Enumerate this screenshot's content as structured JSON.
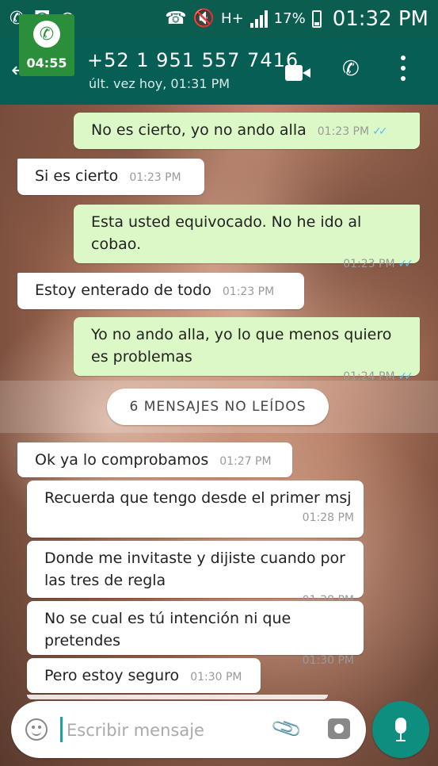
{
  "status_bar": {
    "battery_percent": "17%",
    "time": "01:32 PM",
    "network": "H+"
  },
  "header": {
    "contact": "+52 1 951 557 7416",
    "last_seen": "últ. vez hoy, 01:31 PM",
    "call_duration": "04:55"
  },
  "messages": [
    {
      "dir": "out",
      "text": "No es cierto, yo no ando alla",
      "time": "01:23 PM"
    },
    {
      "dir": "in",
      "text": "Si es cierto",
      "time": "01:23 PM"
    },
    {
      "dir": "out",
      "text": "Esta usted equivocado. No he ido al cobao.",
      "time": "01:23 PM"
    },
    {
      "dir": "in",
      "text": "Estoy enterado de todo",
      "time": "01:23 PM"
    },
    {
      "dir": "out",
      "text": "Yo no ando alla, yo lo que menos quiero es problemas",
      "time": "01:24 PM"
    },
    {
      "dir": "in",
      "text": "Ok ya lo comprobamos",
      "time": "01:27 PM"
    },
    {
      "dir": "in",
      "text": "Recuerda que tengo desde el primer msj",
      "time": "01:28 PM"
    },
    {
      "dir": "in",
      "text": "Donde me invitaste y dijiste cuando por las tres de regla",
      "time": "01:28 PM"
    },
    {
      "dir": "in",
      "text": "No se cual es tú intención ni que pretendes",
      "time": "01:30 PM"
    },
    {
      "dir": "in",
      "text": "Pero estoy seguro",
      "time": "01:30 PM"
    }
  ],
  "unread_banner": "6 MENSAJES NO LEÍDOS",
  "composer": {
    "placeholder": "Escribir mensaje"
  },
  "colors": {
    "header": "#075e54",
    "status_bar": "#0a5d4f",
    "outgoing_bubble": "#dcf8c6",
    "incoming_bubble": "#ffffff",
    "read_check": "#4fc3f7",
    "mic_button": "#0e8e7e"
  }
}
